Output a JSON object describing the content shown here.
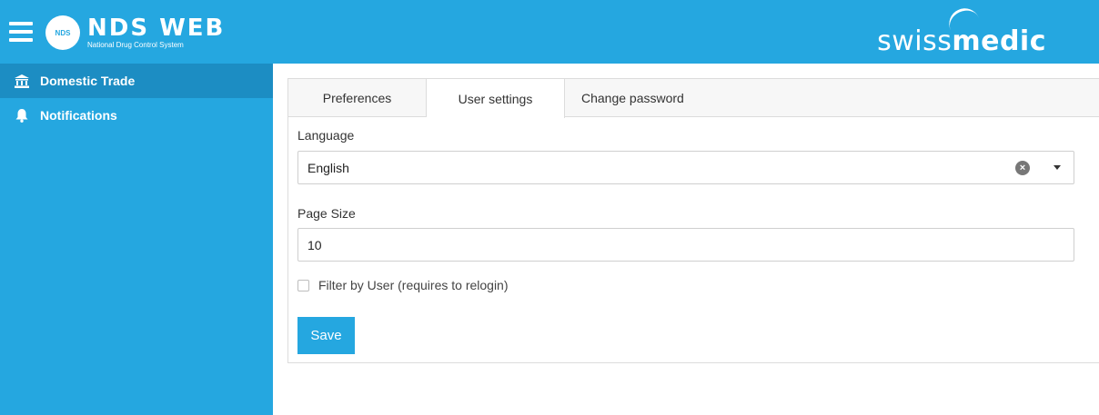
{
  "header": {
    "app_title": "NDS WEB",
    "app_subtitle": "National Drug Control System",
    "logo_badge": "NDS",
    "brand_light": "swiss",
    "brand_bold": "medic",
    "accent_color": "#25a7e0"
  },
  "sidebar": {
    "items": [
      {
        "label": "Domestic Trade",
        "icon": "bank-icon",
        "active": true
      },
      {
        "label": "Notifications",
        "icon": "bell-icon",
        "active": false
      }
    ]
  },
  "tabs": [
    {
      "label": "Preferences",
      "active": false
    },
    {
      "label": "User settings",
      "active": true
    },
    {
      "label": "Change password",
      "active": false
    }
  ],
  "form": {
    "language_label": "Language",
    "language_value": "English",
    "page_size_label": "Page Size",
    "page_size_value": "10",
    "filter_label": "Filter by User (requires to relogin)",
    "filter_checked": false,
    "save_label": "Save"
  }
}
